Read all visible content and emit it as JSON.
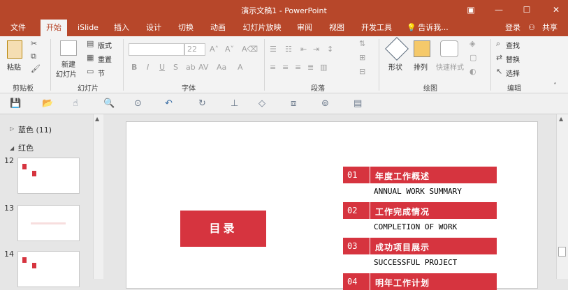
{
  "window": {
    "title": "演示文稿1 - PowerPoint",
    "restore_glyph": "▣",
    "minimize_glyph": "—",
    "maximize_glyph": "☐",
    "close_glyph": "✕"
  },
  "tabs": {
    "file": "文件",
    "home": "开始",
    "islide": "iSlide",
    "insert": "插入",
    "design": "设计",
    "transitions": "切换",
    "animations": "动画",
    "slideshow": "幻灯片放映",
    "review": "审阅",
    "view": "视图",
    "developer": "开发工具",
    "tellme": "告诉我...",
    "login": "登录",
    "share": "共享"
  },
  "ribbon": {
    "clipboard": {
      "paste": "粘贴",
      "label": "剪贴板"
    },
    "slides": {
      "new_slide_line1": "新建",
      "new_slide_line2": "幻灯片",
      "layout": "版式",
      "reset": "重置",
      "section": "节",
      "label": "幻灯片"
    },
    "font": {
      "name_value": "",
      "size_value": "22",
      "bold": "B",
      "italic": "I",
      "underline": "U",
      "strike": "S",
      "label": "字体"
    },
    "paragraph": {
      "label": "段落"
    },
    "drawing": {
      "shapes": "形状",
      "arrange": "排列",
      "quick_styles": "快速样式",
      "label": "绘图"
    },
    "editing": {
      "find": "查找",
      "replace": "替换",
      "select": "选择",
      "label": "编辑"
    }
  },
  "slides_panel": {
    "sections": [
      {
        "name": "蓝色 (11)",
        "collapsed": true
      },
      {
        "name": "红色",
        "collapsed": false
      }
    ],
    "thumb_numbers": [
      "12",
      "13",
      "14"
    ]
  },
  "slide": {
    "title_box": "目录",
    "items": [
      {
        "num": "01",
        "cn": "年度工作概述",
        "en": "ANNUAL WORK SUMMARY"
      },
      {
        "num": "02",
        "cn": "工作完成情况",
        "en": "COMPLETION OF WORK"
      },
      {
        "num": "03",
        "cn": "成功项目展示",
        "en": "SUCCESSFUL PROJECT"
      },
      {
        "num": "04",
        "cn": "明年工作计划",
        "en": ""
      }
    ]
  },
  "colors": {
    "accent": "#b7472a",
    "slide_red": "#d6343f"
  }
}
